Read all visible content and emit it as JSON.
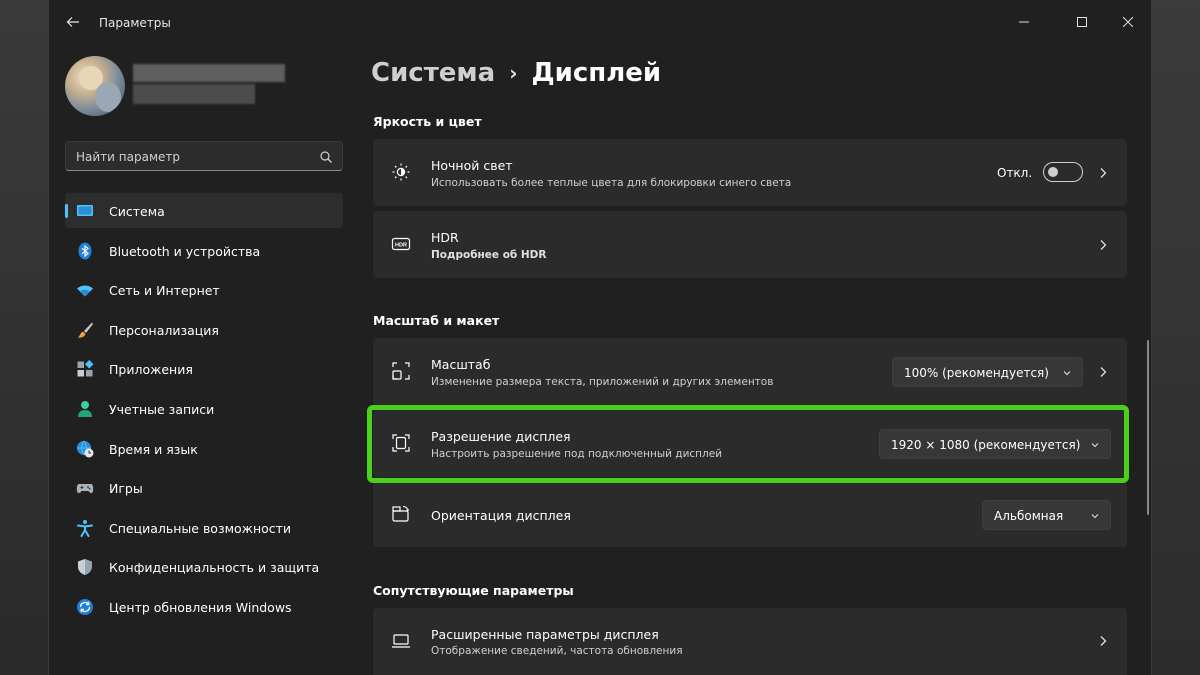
{
  "window": {
    "title": "Параметры"
  },
  "profile": {
    "name_blurred": "",
    "email_blurred": ""
  },
  "search": {
    "placeholder": "Найти параметр"
  },
  "sidebar": {
    "items": [
      {
        "label": "Система",
        "icon": "monitor-icon",
        "active": true
      },
      {
        "label": "Bluetooth и устройства",
        "icon": "bluetooth-icon"
      },
      {
        "label": "Сеть и Интернет",
        "icon": "wifi-icon"
      },
      {
        "label": "Персонализация",
        "icon": "brush-icon"
      },
      {
        "label": "Приложения",
        "icon": "apps-icon"
      },
      {
        "label": "Учетные записи",
        "icon": "person-icon"
      },
      {
        "label": "Время и язык",
        "icon": "globe-clock-icon"
      },
      {
        "label": "Игры",
        "icon": "gamepad-icon"
      },
      {
        "label": "Специальные возможности",
        "icon": "accessibility-icon"
      },
      {
        "label": "Конфиденциальность и защита",
        "icon": "shield-icon"
      },
      {
        "label": "Центр обновления Windows",
        "icon": "update-icon"
      }
    ]
  },
  "breadcrumb": {
    "parent": "Система",
    "separator": "›",
    "current": "Дисплей"
  },
  "sections": {
    "brightness": "Яркость и цвет",
    "scale": "Масштаб и макет",
    "related": "Сопутствующие параметры"
  },
  "night_light": {
    "title": "Ночной свет",
    "subtitle": "Использовать более теплые цвета для блокировки синего света",
    "toggle_label": "Откл.",
    "toggle_on": false
  },
  "hdr": {
    "title": "HDR",
    "subtitle": "Подробнее об HDR"
  },
  "scale": {
    "title": "Масштаб",
    "subtitle": "Изменение размера текста, приложений и других элементов",
    "value": "100% (рекомендуется)"
  },
  "resolution": {
    "title": "Разрешение дисплея",
    "subtitle": "Настроить разрешение под подключенный дисплей",
    "value": "1920 × 1080 (рекомендуется)"
  },
  "orientation": {
    "title": "Ориентация дисплея",
    "value": "Альбомная"
  },
  "advanced": {
    "title": "Расширенные параметры дисплея",
    "subtitle": "Отображение сведений, частота обновления"
  },
  "colors": {
    "accent": "#4cc2ff",
    "highlight": "#4ad11a",
    "window_bg": "#202020",
    "card_bg": "#2b2b2b"
  }
}
